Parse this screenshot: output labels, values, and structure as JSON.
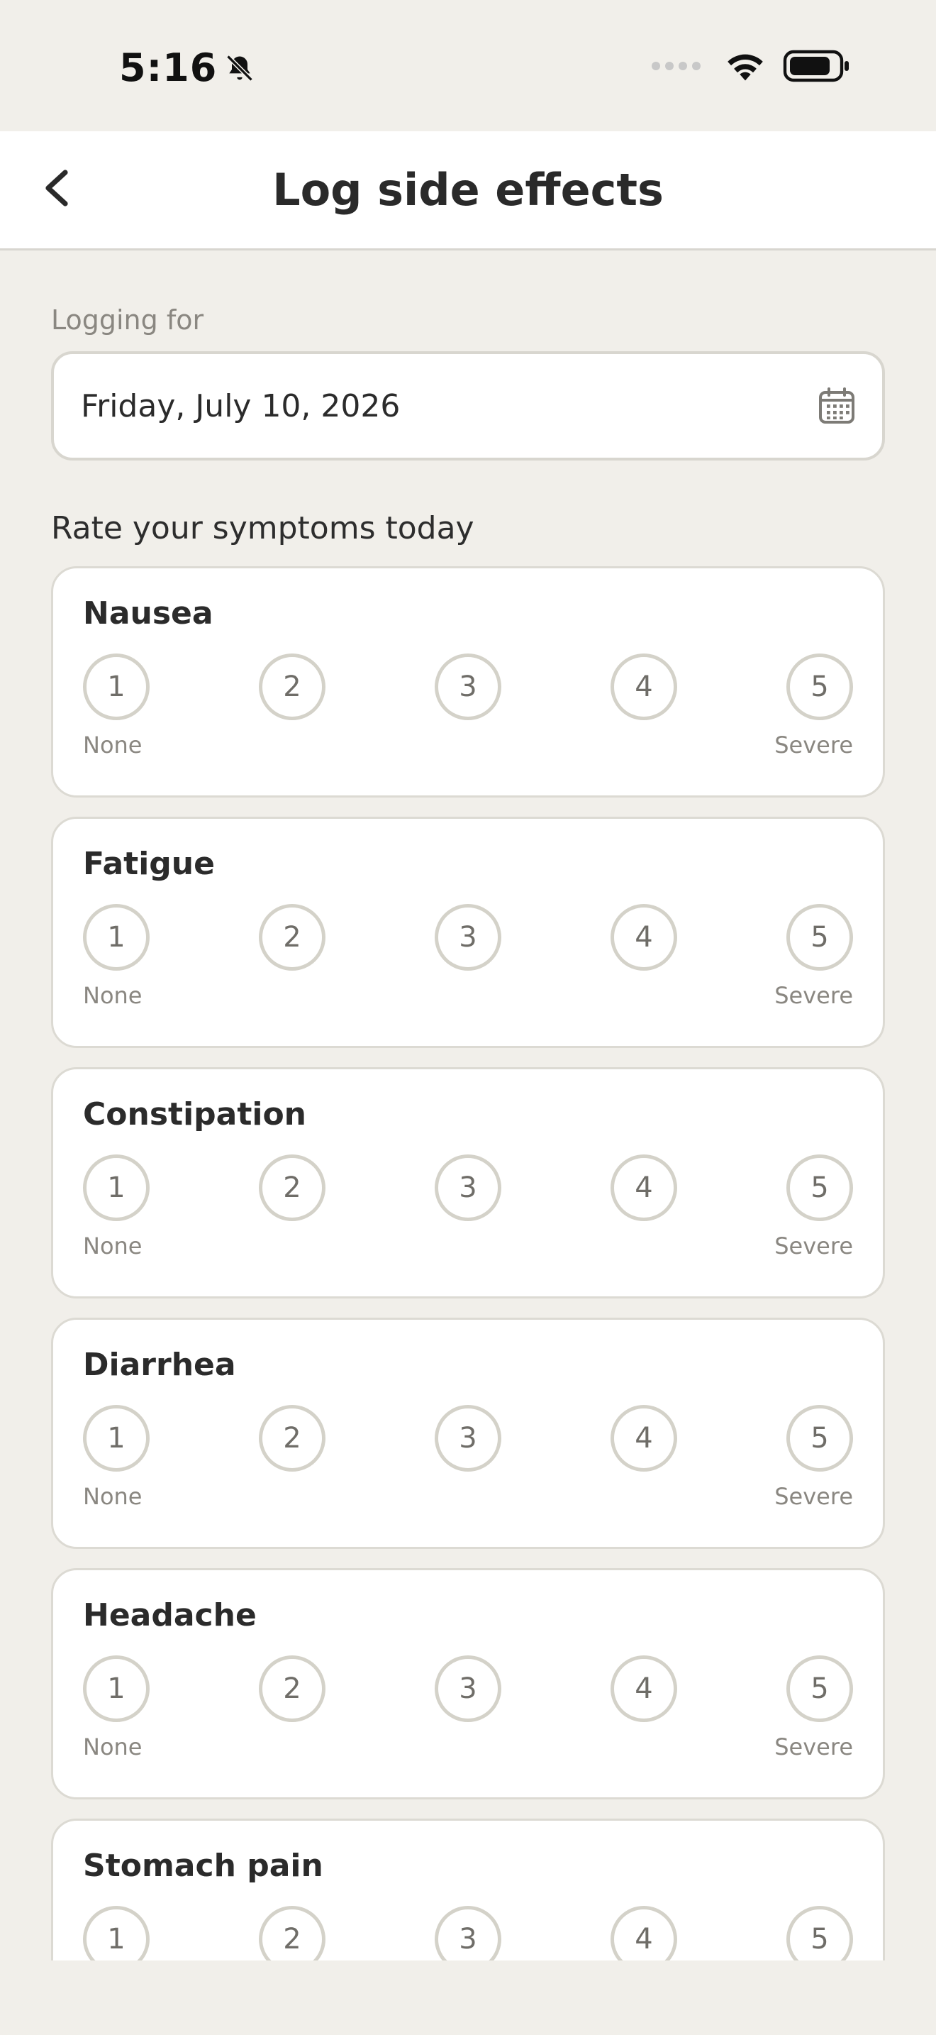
{
  "status_bar": {
    "time": "5:16",
    "icons": [
      "bell-slash-icon",
      "signal-dots-icon",
      "wifi-icon",
      "battery-icon"
    ]
  },
  "header": {
    "title": "Log side effects",
    "back_icon": "chevron-left-icon"
  },
  "logging": {
    "label": "Logging for",
    "date": "Friday, July 10, 2026",
    "calendar_icon": "calendar-icon"
  },
  "section_title": "Rate your symptoms today",
  "scale": {
    "options": [
      "1",
      "2",
      "3",
      "4",
      "5"
    ],
    "low_label": "None",
    "high_label": "Severe"
  },
  "symptoms": [
    {
      "name": "Nausea"
    },
    {
      "name": "Fatigue"
    },
    {
      "name": "Constipation"
    },
    {
      "name": "Diarrhea"
    },
    {
      "name": "Headache"
    },
    {
      "name": "Stomach pain"
    }
  ],
  "colors": {
    "background": "#f1efea",
    "card": "#ffffff",
    "border": "#d8d6cf",
    "text": "#2b2b2b",
    "muted": "#8a8781"
  }
}
